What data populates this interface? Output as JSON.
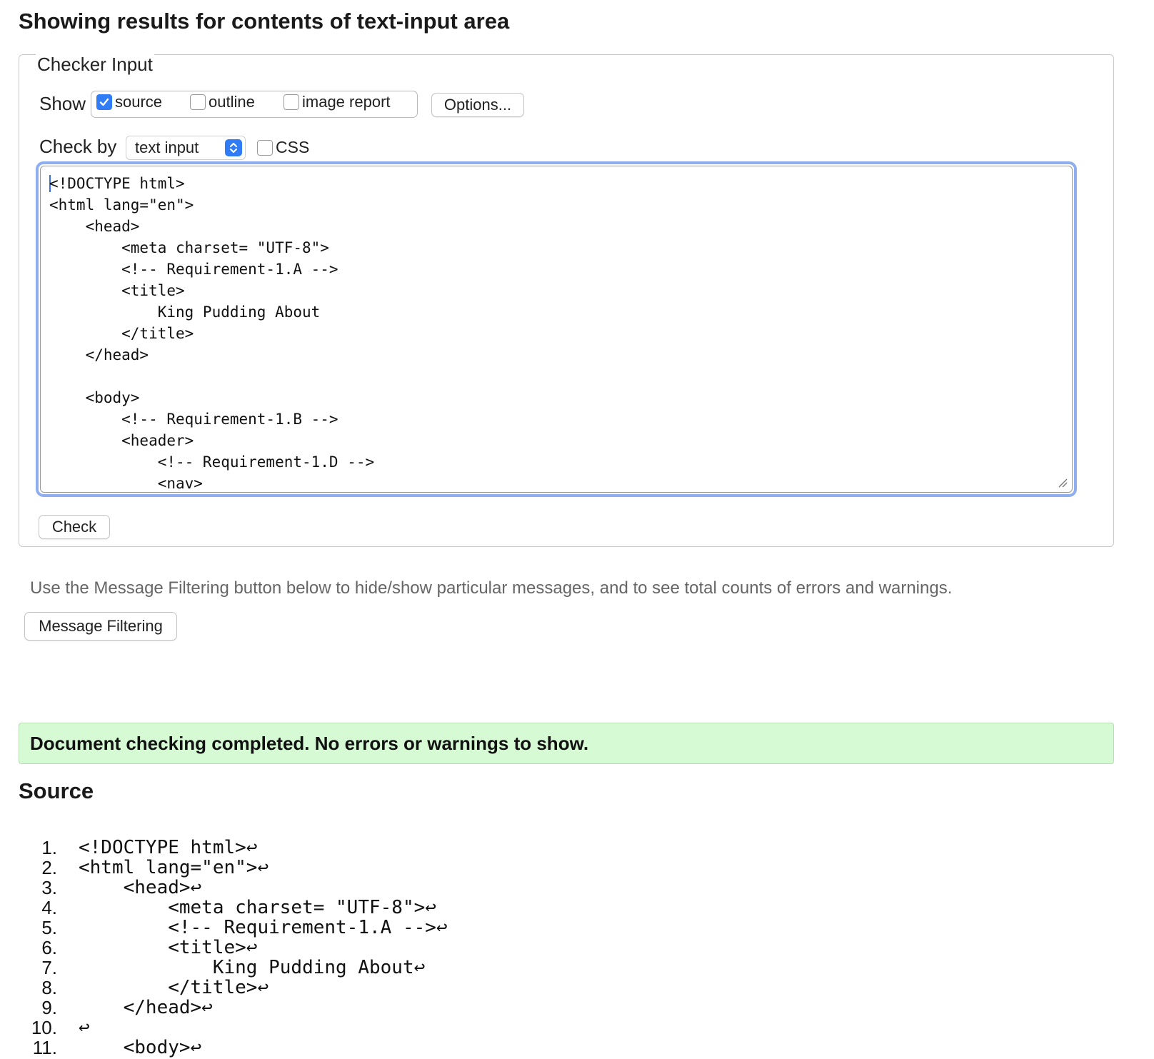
{
  "heading": "Showing results for contents of text-input area",
  "checker": {
    "legend": "Checker Input",
    "show_label": "Show",
    "show_options": [
      {
        "label": "source",
        "checked": true
      },
      {
        "label": "outline",
        "checked": false
      },
      {
        "label": "image report",
        "checked": false
      }
    ],
    "options_button": "Options...",
    "check_by_label": "Check by",
    "check_by_select": {
      "value": "text input"
    },
    "css_label": "CSS",
    "css_checked": false,
    "textarea_lines": [
      "<!DOCTYPE html>",
      "<html lang=\"en\">",
      "    <head>",
      "        <meta charset= \"UTF-8\">",
      "        <!-- Requirement-1.A -->",
      "        <title>",
      "            King Pudding About",
      "        </title>",
      "    </head>",
      "",
      "    <body>",
      "        <!-- Requirement-1.B -->",
      "        <header>",
      "            <!-- Requirement-1.D -->",
      "            <nav>"
    ],
    "check_button": "Check"
  },
  "filter_hint": "Use the Message Filtering button below to hide/show particular messages, and to see total counts of errors and warnings.",
  "filter_button": "Message Filtering",
  "status_message": "Document checking completed. No errors or warnings to show.",
  "colors": {
    "status_bg": "#d6fbd4",
    "accent": "#2f7cf6",
    "focus_ring": "#8eaef0"
  },
  "source": {
    "title": "Source",
    "lines": [
      {
        "num": "1.",
        "text": "<!DOCTYPE html>↩"
      },
      {
        "num": "2.",
        "text": "<html lang=\"en\">↩"
      },
      {
        "num": "3.",
        "text": "    <head>↩"
      },
      {
        "num": "4.",
        "text": "        <meta charset= \"UTF-8\">↩"
      },
      {
        "num": "5.",
        "text": "        <!-- Requirement-1.A -->↩"
      },
      {
        "num": "6.",
        "text": "        <title>↩"
      },
      {
        "num": "7.",
        "text": "            King Pudding About↩"
      },
      {
        "num": "8.",
        "text": "        </title>↩"
      },
      {
        "num": "9.",
        "text": "    </head>↩"
      },
      {
        "num": "10.",
        "text": "↩"
      },
      {
        "num": "11.",
        "text": "    <body>↩"
      }
    ]
  }
}
